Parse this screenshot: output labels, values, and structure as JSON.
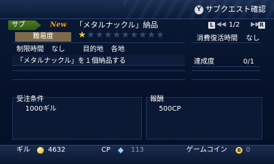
{
  "top_bar": {
    "y_button": "Y",
    "label": "サブクエスト確認"
  },
  "header": {
    "tab_label": "サブ",
    "new_badge": "New",
    "quest_title": "「メタルナックル」納品",
    "l_button": "L",
    "r_button": "R",
    "page_indicator": "1/2"
  },
  "details": {
    "difficulty_label": "難易度",
    "difficulty_stars": 1,
    "difficulty_max": 10,
    "consume_label": "消費復活時間",
    "consume_value": "なし",
    "time_limit_label": "制限時間",
    "time_limit_value": "なし",
    "destination_label": "目的地",
    "destination_value": "各地"
  },
  "objective": {
    "text": "「メタルナックル」を１個納品する",
    "progress_label": "達成度",
    "progress_value": "0/1"
  },
  "conditions": {
    "label": "受注条件",
    "value": "1000ギル"
  },
  "reward": {
    "label": "報酬",
    "value": "500CP"
  },
  "footer": {
    "gil_label": "ギル",
    "gil_value": "4632",
    "cp_label": "CP",
    "cp_value": "113",
    "coin_label": "ゲームコイン",
    "coin_icon_letter": "B",
    "coin_value": "0"
  },
  "colors": {
    "accent_new": "#ff9a18",
    "tab_green": "#3f6a1a",
    "star_gold": "#f2cb3a"
  },
  "icons": {
    "gil": "coin-icon",
    "cp": "crystal-icon",
    "prev": "double-left-arrow-icon",
    "next": "double-right-arrow-icon"
  }
}
